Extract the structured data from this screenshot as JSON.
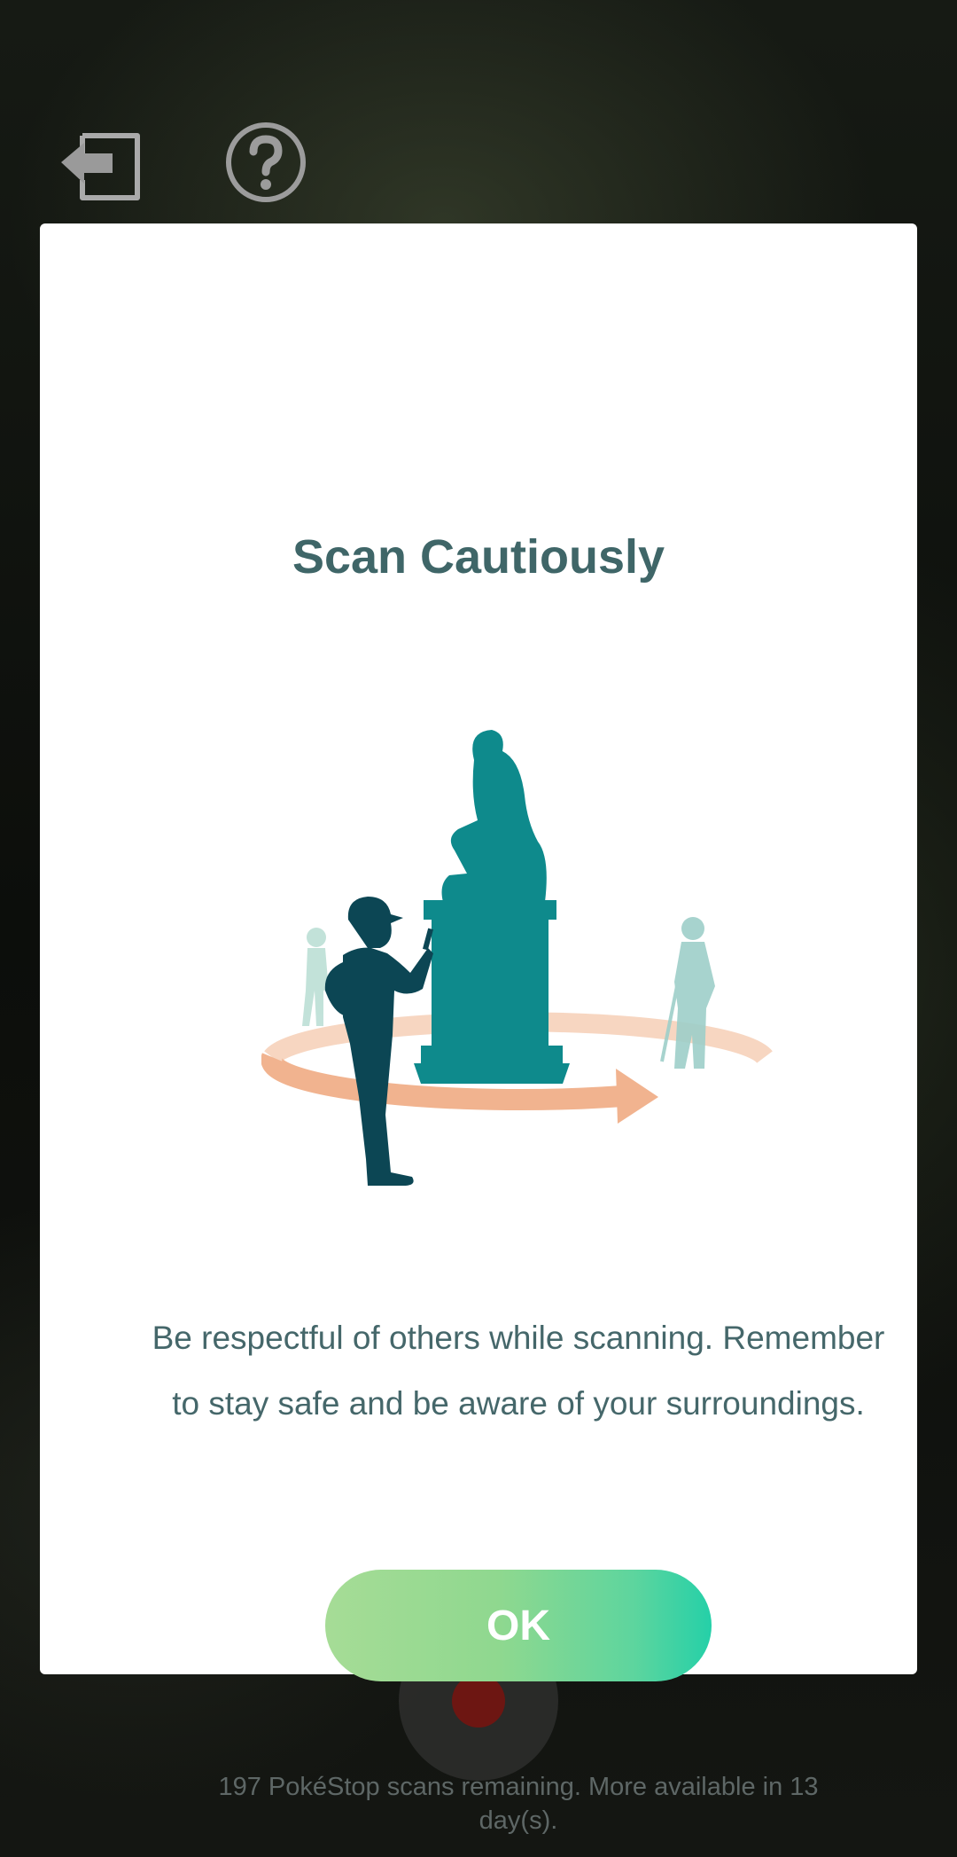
{
  "dialog": {
    "title": "Scan Cautiously",
    "message": "Be respectful of others while scanning. Remember to stay safe and be aware of your surroundings.",
    "ok_label": "OK",
    "footer": "197 PokéStop scans remaining. More available in 13 day(s)."
  },
  "icons": {
    "exit": "exit-icon",
    "help": "help-icon",
    "shutter": "record-button"
  },
  "colors": {
    "title": "#3f6668",
    "statue": "#0e8a8c",
    "player": "#0c4654",
    "ring": "#f1b38f",
    "button_start": "#a6dc96",
    "button_end": "#25d0a8"
  }
}
